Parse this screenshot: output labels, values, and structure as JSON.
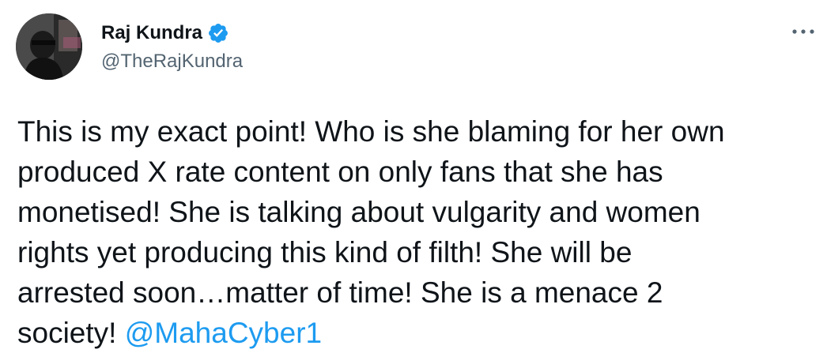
{
  "author": {
    "display_name": "Raj Kundra",
    "handle": "@TheRajKundra",
    "verified": true
  },
  "tweet": {
    "text_lines": [
      "This is my exact point! Who is she blaming for her own",
      "produced X rate content on only fans that she has",
      "monetised! She is talking about vulgarity and women",
      "rights yet producing this kind of filth! She will be",
      "arrested soon…matter of time! She is a menace 2",
      "society! "
    ],
    "mention": "@MahaCyber1"
  },
  "icons": {
    "verified": "verified-badge-icon",
    "more": "more-options-icon"
  },
  "colors": {
    "text": "#0f1419",
    "secondary": "#536471",
    "accent": "#1d9bf0"
  }
}
